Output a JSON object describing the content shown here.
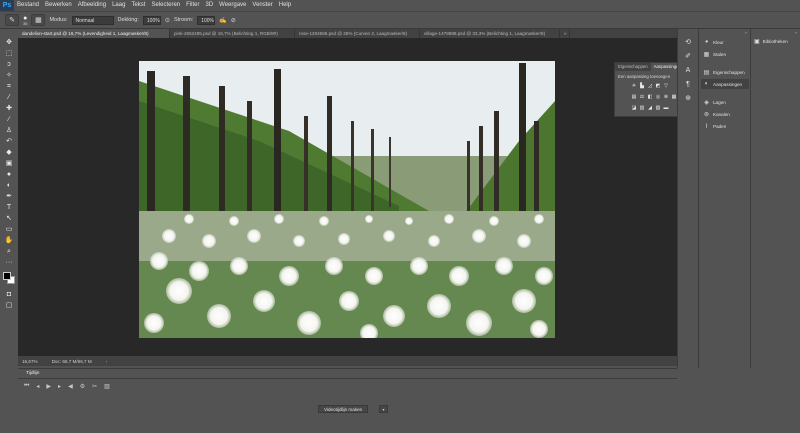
{
  "app": {
    "logo": "Ps"
  },
  "menu": [
    "Bestand",
    "Bewerken",
    "Afbeelding",
    "Laag",
    "Tekst",
    "Selecteren",
    "Filter",
    "3D",
    "Weergave",
    "Venster",
    "Help"
  ],
  "options": {
    "brush_size": "35",
    "mode_label": "Modus:",
    "mode_value": "Normaal",
    "opacity_label": "Dekking:",
    "opacity_value": "100%",
    "flow_label": "Stroom:",
    "flow_value": "100%"
  },
  "tabs": [
    {
      "label": "dandelion-start.psd @ 16,7% (Levendigheid 1, Laagmasker/8)",
      "active": true
    },
    {
      "label": "pink-2652485.psd @ 16,7% (Belichting 1, RGB/8#)",
      "active": false
    },
    {
      "label": "rose-1204686.psd @ 25% (Curven 2, Laagmasker/8)",
      "active": false
    },
    {
      "label": "village-1478888.psd @ 33,3% (Belichting 1, Laagmasker/8)",
      "active": false
    }
  ],
  "status": {
    "zoom": "16,67%",
    "doc": "Doc: 66,7 M/66,7 M"
  },
  "timeline": {
    "tab": "Tijdlijn",
    "create_button": "Videotijdlijn maken"
  },
  "adjustments_panel": {
    "tabs": [
      "Eigenschappen",
      "Aanpassingen"
    ],
    "active_tab": "Aanpassingen",
    "title": "Een aanpassing toevoegen"
  },
  "dock": [
    {
      "label": "Kleur",
      "icon": "color-wheel-icon"
    },
    {
      "label": "Stalen",
      "icon": "swatches-icon"
    },
    {
      "label": "Eigenschappen",
      "icon": "properties-icon"
    },
    {
      "label": "Aanpassingen",
      "icon": "adjustments-icon"
    },
    {
      "label": "Lagen",
      "icon": "layers-icon"
    },
    {
      "label": "Kanalen",
      "icon": "channels-icon"
    },
    {
      "label": "Paden",
      "icon": "paths-icon"
    }
  ],
  "library": {
    "label": "Bibliotheken"
  },
  "colors": {
    "foreground": "#000000",
    "background": "#ffffff",
    "accent": "#31a8ff"
  }
}
